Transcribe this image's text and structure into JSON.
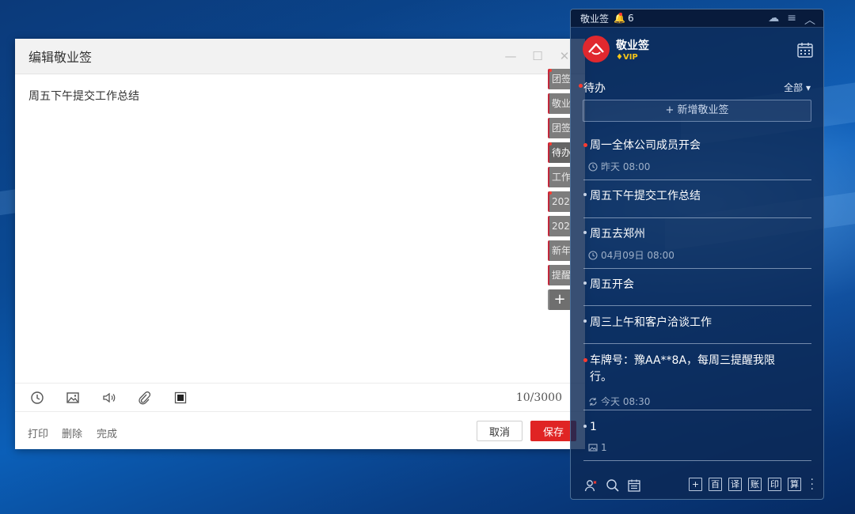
{
  "colors": {
    "accent_red": "#e02424",
    "panel_bg": "#0c2854",
    "tab_gray": "#7d7d7d"
  },
  "editor": {
    "title": "编辑敬业签",
    "content": "周五下午提交工作总结",
    "counter": "10/3000",
    "toolbar_icons": [
      "clock-icon",
      "image-icon",
      "speaker-icon",
      "paperclip-icon",
      "stop-icon"
    ],
    "footer": {
      "print": "打印",
      "delete": "删除",
      "done": "完成",
      "cancel": "取消",
      "save": "保存"
    },
    "side_tabs": [
      "团签",
      "敬业",
      "团签",
      "待办",
      "工作",
      "202",
      "202",
      "新年",
      "提醒"
    ],
    "side_tab_add": "+"
  },
  "panel": {
    "title": "敬业签",
    "bell_count": "6",
    "brand": "敬业签",
    "vip": "VIP",
    "filter_label": "待办",
    "filter_right": "全部",
    "new_note": "+ 新增敬业签",
    "notes": [
      {
        "title": "周一全体公司成员开会",
        "meta": "昨天 08:00",
        "meta_icon": "clock-icon",
        "red": true
      },
      {
        "title": "周五下午提交工作总结",
        "meta": "",
        "meta_icon": "",
        "red": false
      },
      {
        "title": "周五去郑州",
        "meta": "04月09日 08:00",
        "meta_icon": "clock-icon",
        "red": false
      },
      {
        "title": "周五开会",
        "meta": "",
        "meta_icon": "",
        "red": false
      },
      {
        "title": "周三上午和客户洽谈工作",
        "meta": "",
        "meta_icon": "",
        "red": false
      },
      {
        "title": "车牌号：豫AA**8A，每周三提醒我限行。",
        "meta": "今天 08:30",
        "meta_icon": "repeat-icon",
        "red": true
      },
      {
        "title": "1",
        "meta": "1",
        "meta_icon": "image-icon",
        "red": false
      }
    ],
    "bottom_boxes": [
      "+",
      "百",
      "译",
      "账",
      "印",
      "算"
    ]
  }
}
